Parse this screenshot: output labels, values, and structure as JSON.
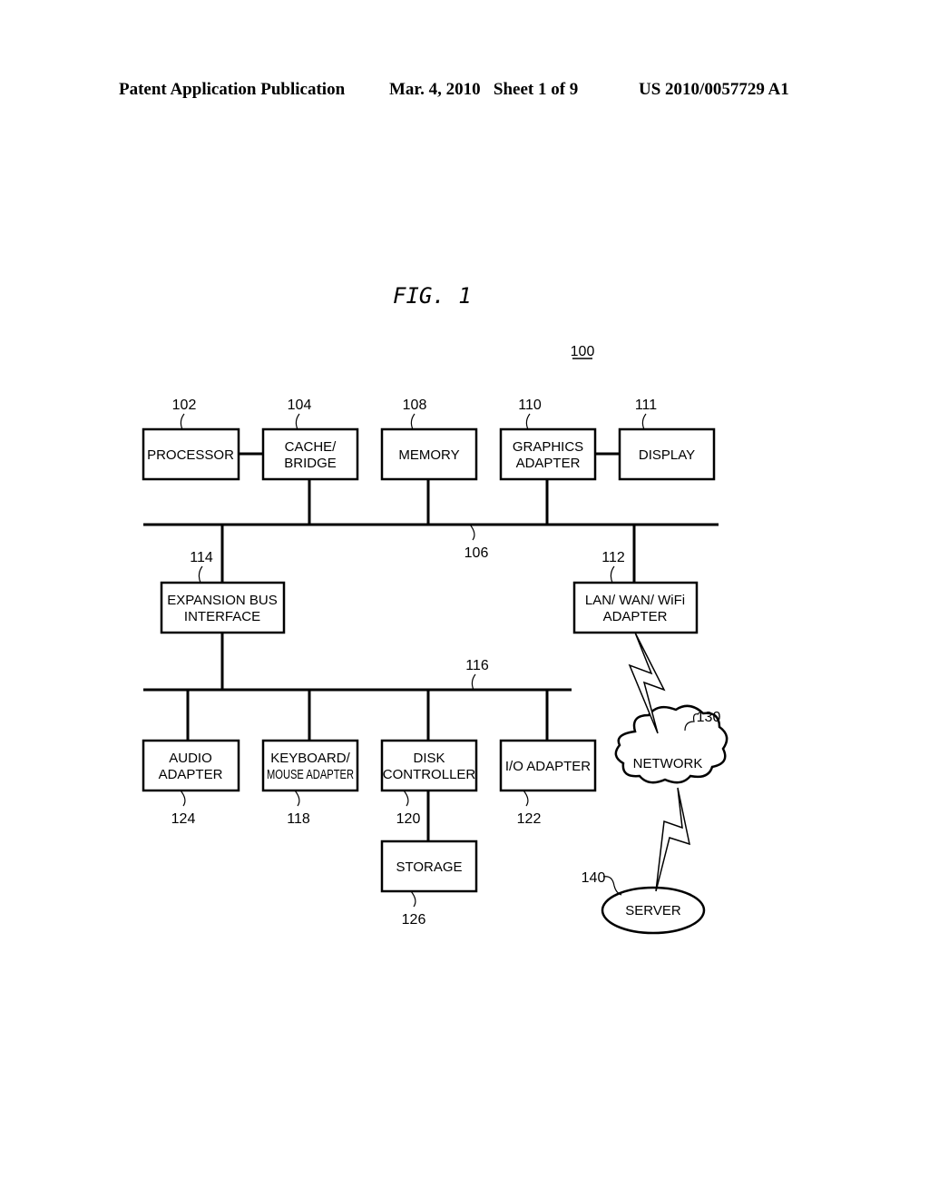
{
  "header": {
    "publication": "Patent Application Publication",
    "date_sheet": "Mar. 4, 2010   Sheet 1 of 9",
    "number": "US 2010/0057729 A1"
  },
  "figure": {
    "title": "FIG. 1",
    "system_ref": "100",
    "blocks": {
      "processor": {
        "ref": "102",
        "lines": [
          "PROCESSOR"
        ]
      },
      "cache_bridge": {
        "ref": "104",
        "lines": [
          "CACHE/",
          "BRIDGE"
        ]
      },
      "memory": {
        "ref": "108",
        "lines": [
          "MEMORY"
        ]
      },
      "graphics_adapter": {
        "ref": "110",
        "lines": [
          "GRAPHICS",
          "ADAPTER"
        ]
      },
      "display": {
        "ref": "111",
        "lines": [
          "DISPLAY"
        ]
      },
      "expansion_bus_interface": {
        "ref": "114",
        "lines": [
          "EXPANSION BUS",
          "INTERFACE"
        ]
      },
      "lan_wan_wifi_adapter": {
        "ref": "112",
        "lines": [
          "LAN/ WAN/ WiFi",
          "ADAPTER"
        ]
      },
      "audio_adapter": {
        "ref": "124",
        "lines": [
          "AUDIO",
          "ADAPTER"
        ]
      },
      "keyboard_mouse_adapter": {
        "ref": "118",
        "lines": [
          "KEYBOARD/",
          "MOUSE ADAPTER"
        ]
      },
      "disk_controller": {
        "ref": "120",
        "lines": [
          "DISK",
          "CONTROLLER"
        ]
      },
      "io_adapter": {
        "ref": "122",
        "lines": [
          "I/O ADAPTER"
        ]
      },
      "storage": {
        "ref": "126",
        "lines": [
          "STORAGE"
        ]
      },
      "network": {
        "ref": "130",
        "lines": [
          "NETWORK"
        ]
      },
      "server": {
        "ref": "140",
        "lines": [
          "SERVER"
        ]
      }
    },
    "buses": {
      "system_bus": {
        "ref": "106"
      },
      "expansion_bus": {
        "ref": "116"
      }
    }
  }
}
